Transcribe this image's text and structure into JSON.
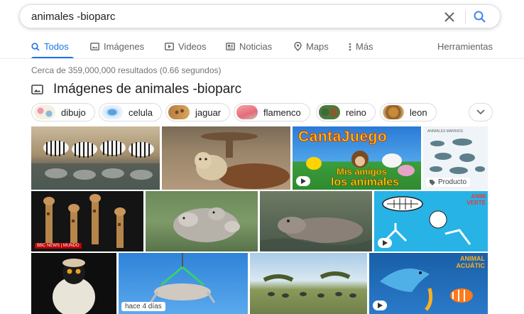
{
  "search": {
    "query": "animales -bioparc"
  },
  "tabs": [
    {
      "label": "Todos",
      "icon": "search-icon",
      "active": true
    },
    {
      "label": "Imágenes",
      "icon": "image-icon"
    },
    {
      "label": "Videos",
      "icon": "play-icon"
    },
    {
      "label": "Noticias",
      "icon": "newspaper-icon"
    },
    {
      "label": "Maps",
      "icon": "map-pin-icon"
    },
    {
      "label": "Más",
      "icon": "more-vert-icon"
    },
    {
      "label": "Herramientas"
    }
  ],
  "result_stats": "Cerca de 359,000,000 resultados (0.66 segundos)",
  "images_section": {
    "title": "Imágenes de animales -bioparc"
  },
  "chips": [
    {
      "label": "dibujo"
    },
    {
      "label": "celula"
    },
    {
      "label": "jaguar"
    },
    {
      "label": "flamenco"
    },
    {
      "label": "reino"
    },
    {
      "label": "leon"
    }
  ],
  "tiles": {
    "cantajuego_title": "CantaJuego",
    "cantajuego_sub1": "Mis amigos",
    "cantajuego_sub2": "los animales",
    "marine_header": "ANIMALES MARINOS",
    "producto": "Producto",
    "bbc": "BBC NEWS | MUNDO",
    "vertebrados": "ANIM VERTE",
    "acuaticos_1": "ANIMAL",
    "acuaticos_2": "ACUÁTIC",
    "hace": "hace 4 días"
  },
  "colors": {
    "accent": "#1a73e8",
    "text": "#202124",
    "muted": "#70757a",
    "tab": "#5f6368"
  }
}
